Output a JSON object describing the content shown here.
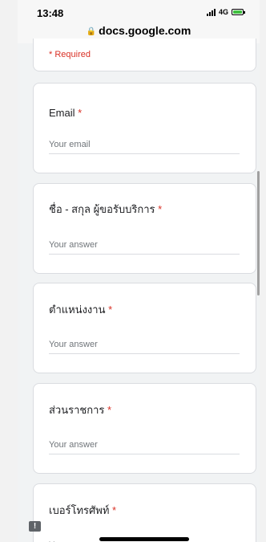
{
  "status": {
    "time": "13:48",
    "network": "4G"
  },
  "browser": {
    "url": "docs.google.com"
  },
  "form": {
    "required_note": "* Required",
    "questions": [
      {
        "label": "Email",
        "star": "*",
        "placeholder": "Your email"
      },
      {
        "label": "ชื่อ - สกุล ผู้ขอรับบริการ",
        "star": "*",
        "placeholder": "Your answer"
      },
      {
        "label": "ตำแหน่งงาน",
        "star": "*",
        "placeholder": "Your answer"
      },
      {
        "label": "ส่วนราชการ",
        "star": "*",
        "placeholder": "Your answer"
      },
      {
        "label": "เบอร์โทรศัพท์",
        "star": "*",
        "placeholder": "Your answer"
      }
    ]
  },
  "colors": {
    "required_red": "#d93025",
    "page_bg": "#f1f3f4",
    "card_bg": "#ffffff"
  },
  "icons": {
    "lock": "lock-icon",
    "signal": "signal-icon",
    "battery": "battery-icon",
    "feedback": "feedback-icon"
  }
}
